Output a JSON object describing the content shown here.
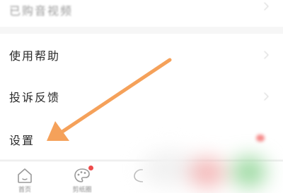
{
  "menu": {
    "items": [
      {
        "label": "已购音视频"
      },
      {
        "label": "使用帮助"
      },
      {
        "label": "投诉反馈"
      },
      {
        "label": "设置"
      }
    ]
  },
  "tabbar": {
    "tabs": [
      {
        "label": "首页",
        "icon": "home-icon"
      },
      {
        "label": "剪纸圈",
        "icon": "palette-icon",
        "badge": true
      },
      {
        "label": "",
        "icon": "partial-tab-icon"
      }
    ]
  },
  "colors": {
    "arrow": "#f5a15a",
    "badge": "#ee4b4b"
  }
}
